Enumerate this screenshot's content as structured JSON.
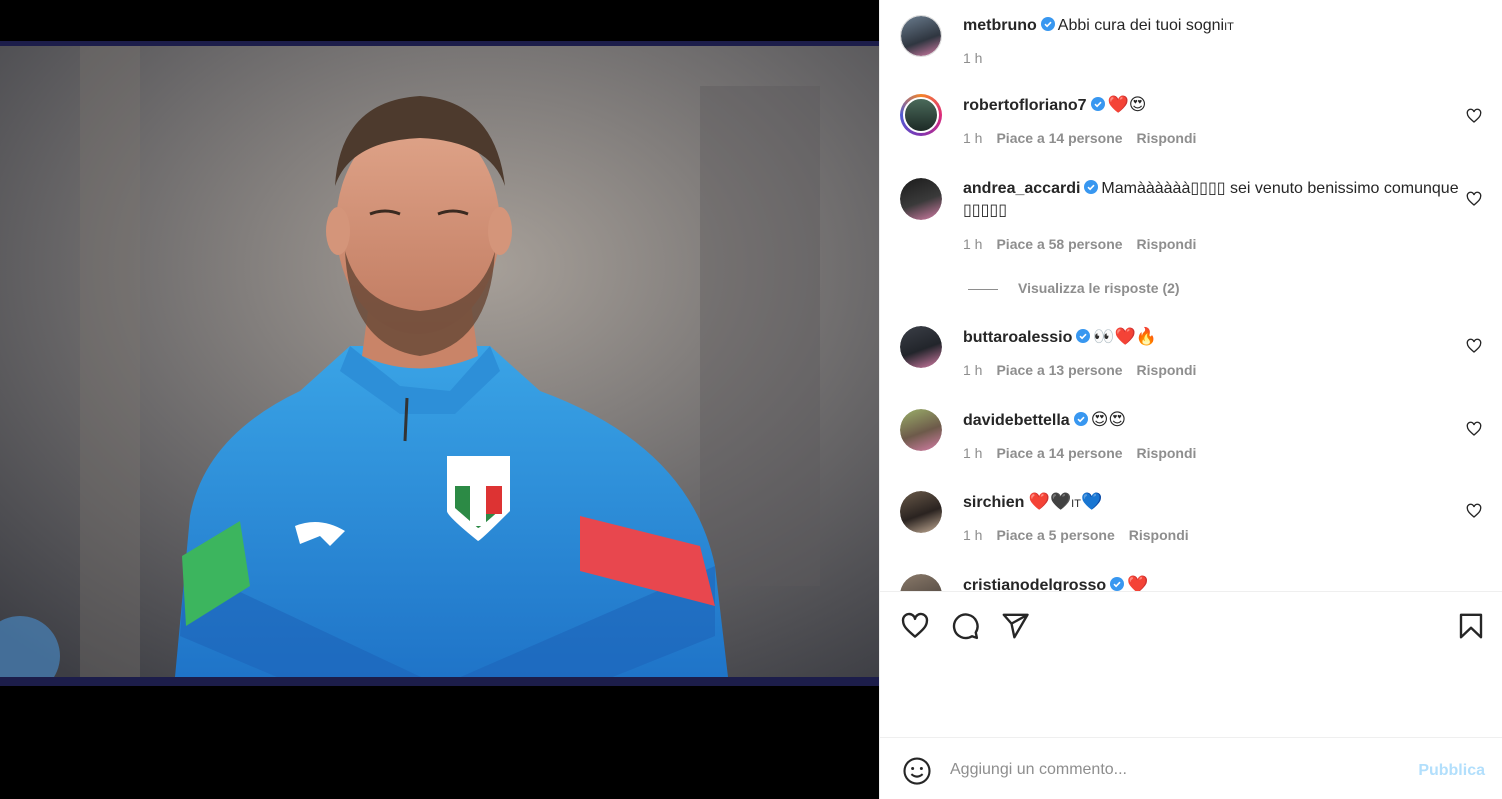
{
  "post": {
    "author": "metbruno",
    "caption": "Abbi cura dei tuoi sogni",
    "caption_flag": "IT",
    "time": "1 h"
  },
  "comments": [
    {
      "user": "robertofloriano7",
      "text": "❤️😍",
      "time": "1 h",
      "likes": "Piace a 14 persone",
      "reply": "Rispondi"
    },
    {
      "user": "andrea_accardi",
      "text": "Mamàààààà▯▯▯▯ sei venuto benissimo comunque ▯▯▯▯▯",
      "time": "1 h",
      "likes": "Piace a 58 persone",
      "reply": "Rispondi"
    },
    {
      "user": "buttaroalessio",
      "text": "👀❤️🔥",
      "time": "1 h",
      "likes": "Piace a 13 persone",
      "reply": "Rispondi"
    },
    {
      "user": "davidebettella",
      "text": "😍😍",
      "time": "1 h",
      "likes": "Piace a 14 persone",
      "reply": "Rispondi"
    },
    {
      "user": "sirchien",
      "text": "❤️🖤",
      "text_flag": "IT",
      "text_end": "💙",
      "time": "1 h",
      "likes": "Piace a 5 persone",
      "reply": "Rispondi"
    },
    {
      "user": "cristianodelgrosso",
      "text": "❤️"
    }
  ],
  "view_replies": "Visualizza le risposte (2)",
  "add_comment": {
    "placeholder": "Aggiungi un commento...",
    "publish": "Pubblica"
  },
  "icons": [
    "heart-icon",
    "comment-icon",
    "share-icon",
    "bookmark-icon",
    "emoji-icon",
    "verified-icon"
  ],
  "colors": {
    "verified": "#3897f0",
    "publish_disabled": "#b2dffc",
    "meta": "#8e8e8e"
  }
}
